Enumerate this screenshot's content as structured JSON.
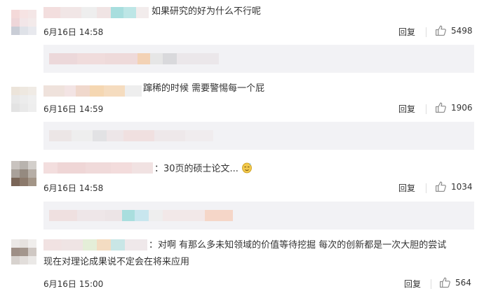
{
  "comments": [
    {
      "text": "如果研究的好为什么不行呢",
      "time": "6月16日 14:58",
      "reply_label": "回复",
      "likes": "5498"
    },
    {
      "text": "蹿稀的时候 需要警惕每一个屁",
      "time": "6月16日 14:59",
      "reply_label": "回复",
      "likes": "1906"
    },
    {
      "text": "：30页的硕士论文...",
      "time": "6月16日 14:58",
      "reply_label": "回复",
      "likes": "1034"
    },
    {
      "text_line1": "：对啊 有那么多未知领域的价值等待挖掘 每次的创新都是一次大胆的尝试",
      "text_line2": "现在对理论成果说不定会在将来应用",
      "time": "6月16日 15:00",
      "reply_label": "回复",
      "likes": "564"
    }
  ],
  "colors": {
    "sub_reply_bg": "#f2f2f5",
    "text": "#333333",
    "icon": "#8a8a8a"
  },
  "icons": {
    "like": "thumbs-up-icon",
    "emoji": "sweat-smile-emoji-icon"
  }
}
